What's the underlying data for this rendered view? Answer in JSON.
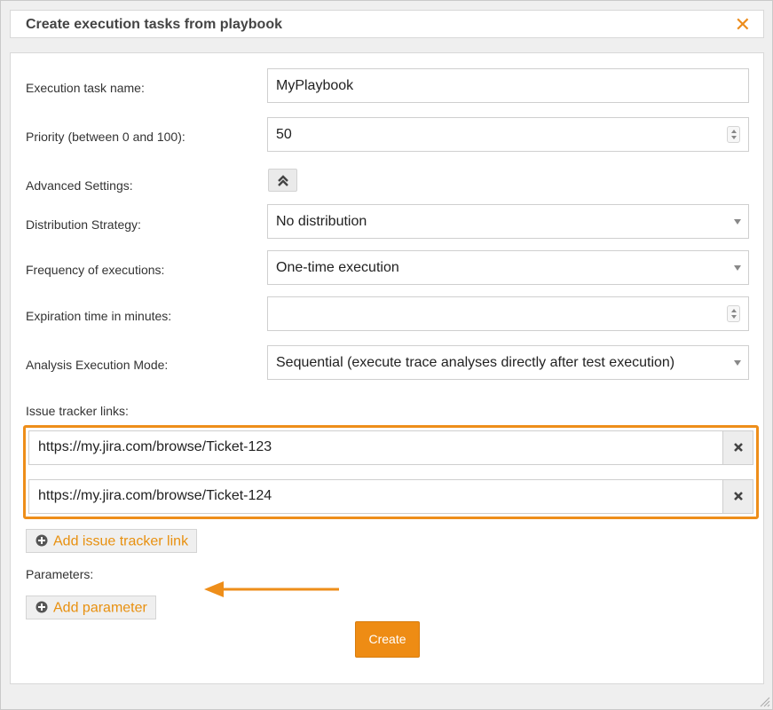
{
  "dialog": {
    "title": "Create execution tasks from playbook",
    "close_symbol": "✕"
  },
  "form": {
    "task_name": {
      "label": "Execution task name:",
      "value": "MyPlaybook"
    },
    "priority": {
      "label": "Priority (between 0 and 100):",
      "value": "50"
    },
    "advanced": {
      "label": "Advanced Settings:"
    },
    "distribution": {
      "label": "Distribution Strategy:",
      "value": "No distribution"
    },
    "frequency": {
      "label": "Frequency of executions:",
      "value": "One-time execution"
    },
    "expiration": {
      "label": "Expiration time in minutes:",
      "value": ""
    },
    "analysis_mode": {
      "label": "Analysis Execution Mode:",
      "value": "Sequential (execute trace analyses directly after test execution)"
    },
    "issue_links": {
      "label": "Issue tracker links:",
      "items": [
        {
          "url": "https://my.jira.com/browse/Ticket-123"
        },
        {
          "url": "https://my.jira.com/browse/Ticket-124"
        }
      ],
      "add_label": "Add issue tracker link"
    },
    "parameters": {
      "label": "Parameters:",
      "add_label": "Add parameter"
    },
    "create_label": "Create"
  },
  "colors": {
    "accent": "#ee8e1a",
    "text": "#333333",
    "border": "#cfcfcf"
  }
}
